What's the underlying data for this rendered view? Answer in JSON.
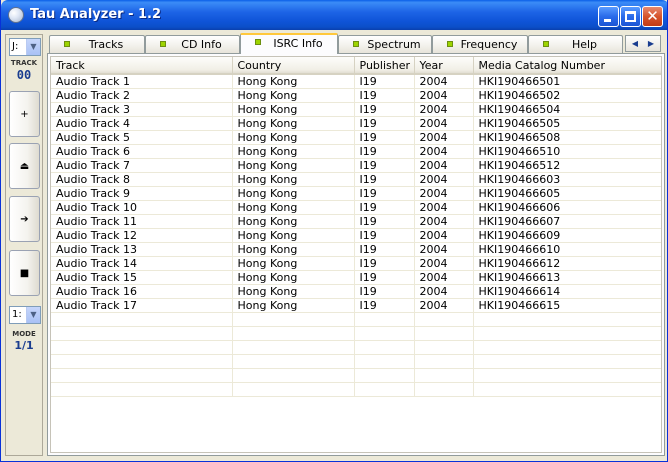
{
  "window": {
    "title": "Tau Analyzer - 1.2"
  },
  "left_panel": {
    "drive_select": "J:",
    "track_label": "TRACK",
    "track_number": "00",
    "buttons": [
      {
        "name": "add-button",
        "glyph": "+"
      },
      {
        "name": "eject-button",
        "glyph": "⏏"
      },
      {
        "name": "play-button",
        "glyph": "➔"
      },
      {
        "name": "stop-button",
        "glyph": "■"
      }
    ],
    "mode_select": "1:",
    "mode_label": "MODE",
    "mode_value": "1/1"
  },
  "tabs": [
    {
      "label": "Tracks",
      "active": false
    },
    {
      "label": "CD Info",
      "active": false
    },
    {
      "label": "ISRC Info",
      "active": true
    },
    {
      "label": "Spectrum",
      "active": false
    },
    {
      "label": "Frequency",
      "active": false
    },
    {
      "label": "Help",
      "active": false
    }
  ],
  "table": {
    "columns": [
      "Track",
      "Country",
      "Publisher",
      "Year",
      "Media Catalog Number"
    ],
    "rows": [
      [
        "Audio Track 1",
        "Hong Kong",
        "I19",
        "2004",
        "HKI190466501"
      ],
      [
        "Audio Track 2",
        "Hong Kong",
        "I19",
        "2004",
        "HKI190466502"
      ],
      [
        "Audio Track 3",
        "Hong Kong",
        "I19",
        "2004",
        "HKI190466504"
      ],
      [
        "Audio Track 4",
        "Hong Kong",
        "I19",
        "2004",
        "HKI190466505"
      ],
      [
        "Audio Track 5",
        "Hong Kong",
        "I19",
        "2004",
        "HKI190466508"
      ],
      [
        "Audio Track 6",
        "Hong Kong",
        "I19",
        "2004",
        "HKI190466510"
      ],
      [
        "Audio Track 7",
        "Hong Kong",
        "I19",
        "2004",
        "HKI190466512"
      ],
      [
        "Audio Track 8",
        "Hong Kong",
        "I19",
        "2004",
        "HKI190466603"
      ],
      [
        "Audio Track 9",
        "Hong Kong",
        "I19",
        "2004",
        "HKI190466605"
      ],
      [
        "Audio Track 10",
        "Hong Kong",
        "I19",
        "2004",
        "HKI190466606"
      ],
      [
        "Audio Track 11",
        "Hong Kong",
        "I19",
        "2004",
        "HKI190466607"
      ],
      [
        "Audio Track 12",
        "Hong Kong",
        "I19",
        "2004",
        "HKI190466609"
      ],
      [
        "Audio Track 13",
        "Hong Kong",
        "I19",
        "2004",
        "HKI190466610"
      ],
      [
        "Audio Track 14",
        "Hong Kong",
        "I19",
        "2004",
        "HKI190466612"
      ],
      [
        "Audio Track 15",
        "Hong Kong",
        "I19",
        "2004",
        "HKI190466613"
      ],
      [
        "Audio Track 16",
        "Hong Kong",
        "I19",
        "2004",
        "HKI190466614"
      ],
      [
        "Audio Track 17",
        "Hong Kong",
        "I19",
        "2004",
        "HKI190466615"
      ]
    ]
  },
  "colors": {
    "title_bar": "#0a5fe8",
    "close_button": "#d6542c",
    "tab_active_accent": "#ffc83c",
    "led": "#9dd400"
  }
}
